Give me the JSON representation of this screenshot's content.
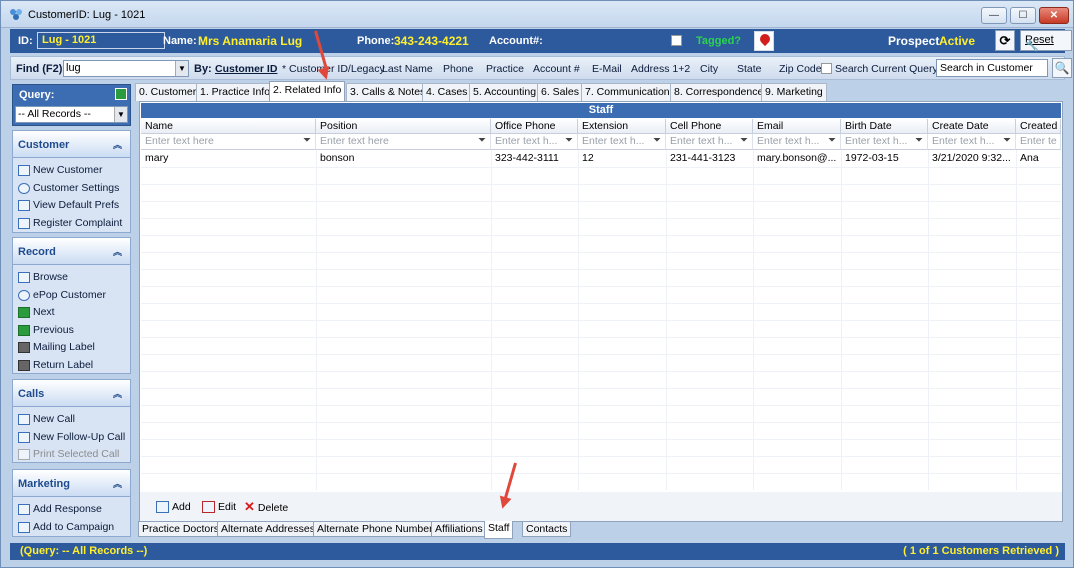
{
  "window": {
    "title": "CustomerID: Lug - 1021",
    "min": "—",
    "max": "☐",
    "close": "✕"
  },
  "info": {
    "id_label": "ID:",
    "id_value": "Lug - 1021",
    "name_label": "Name:",
    "name_value": "Mrs Anamaria Lug",
    "phone_label": "Phone:",
    "phone_value": "343-243-4221",
    "account_label": "Account#:",
    "tagged_label": "Tagged?",
    "prospect_label": "Prospect",
    "status_value": "Active",
    "refresh_label": "⟳",
    "reset_label": "Reset"
  },
  "find": {
    "label": "Find (F2)",
    "value": "lug",
    "by_label": "By:",
    "by_options": [
      "Customer ID",
      "* Customer ID/Legacy",
      "Last Name",
      "Phone",
      "Practice",
      "Account #",
      "E-Mail",
      "Address 1+2",
      "City",
      "State",
      "Zip Code"
    ],
    "search_current_label": "Search Current Query",
    "search_in_value": "Search in Customer",
    "search_icon": "🔍"
  },
  "sidebar": {
    "query_title": "Query:",
    "query_value": "-- All Records --",
    "groups": [
      {
        "title": "Customer",
        "items": [
          "New Customer",
          "Customer Settings",
          "View Default Prefs",
          "Register Complaint"
        ]
      },
      {
        "title": "Record",
        "items": [
          "Browse",
          "ePop Customer",
          "Next",
          "Previous",
          "Mailing Label",
          "Return Label"
        ]
      },
      {
        "title": "Calls",
        "items": [
          "New Call",
          "New Follow-Up Call",
          "Print Selected Call"
        ]
      },
      {
        "title": "Marketing",
        "items": [
          "Add Response",
          "Add to Campaign"
        ]
      }
    ]
  },
  "tabs": [
    "0. Customer",
    "1. Practice Info",
    "2. Related Info",
    "3. Calls & Notes",
    "4. Cases",
    "5. Accounting",
    "6. Sales",
    "7. Communications",
    "8. Correspondence",
    "9. Marketing"
  ],
  "active_tab": "2. Related Info",
  "staff": {
    "title": "Staff",
    "columns": [
      "Name",
      "Position",
      "Office Phone",
      "Extension",
      "Cell Phone",
      "Email",
      "Birth Date",
      "Create Date",
      "Created"
    ],
    "filters": [
      "Enter text here",
      "Enter text here",
      "Enter text h...",
      "Enter text h...",
      "Enter text h...",
      "Enter text h...",
      "Enter text h...",
      "Enter text h...",
      "Enter te"
    ],
    "rows": [
      [
        "mary",
        "bonson",
        "323-442-3111",
        "12",
        "231-441-3123",
        "mary.bonson@...",
        "1972-03-15",
        "3/21/2020 9:32...",
        "Ana"
      ]
    ]
  },
  "actions": {
    "add": "Add",
    "edit": "Edit",
    "delete": "Delete"
  },
  "bottom_tabs": [
    "Practice Doctors",
    "Alternate Addresses",
    "Alternate Phone Numbers",
    "Affiliations",
    "Staff",
    "Contacts"
  ],
  "status": {
    "left": "(Query: -- All Records --)",
    "right": "( 1 of 1 Customers Retrieved )"
  }
}
